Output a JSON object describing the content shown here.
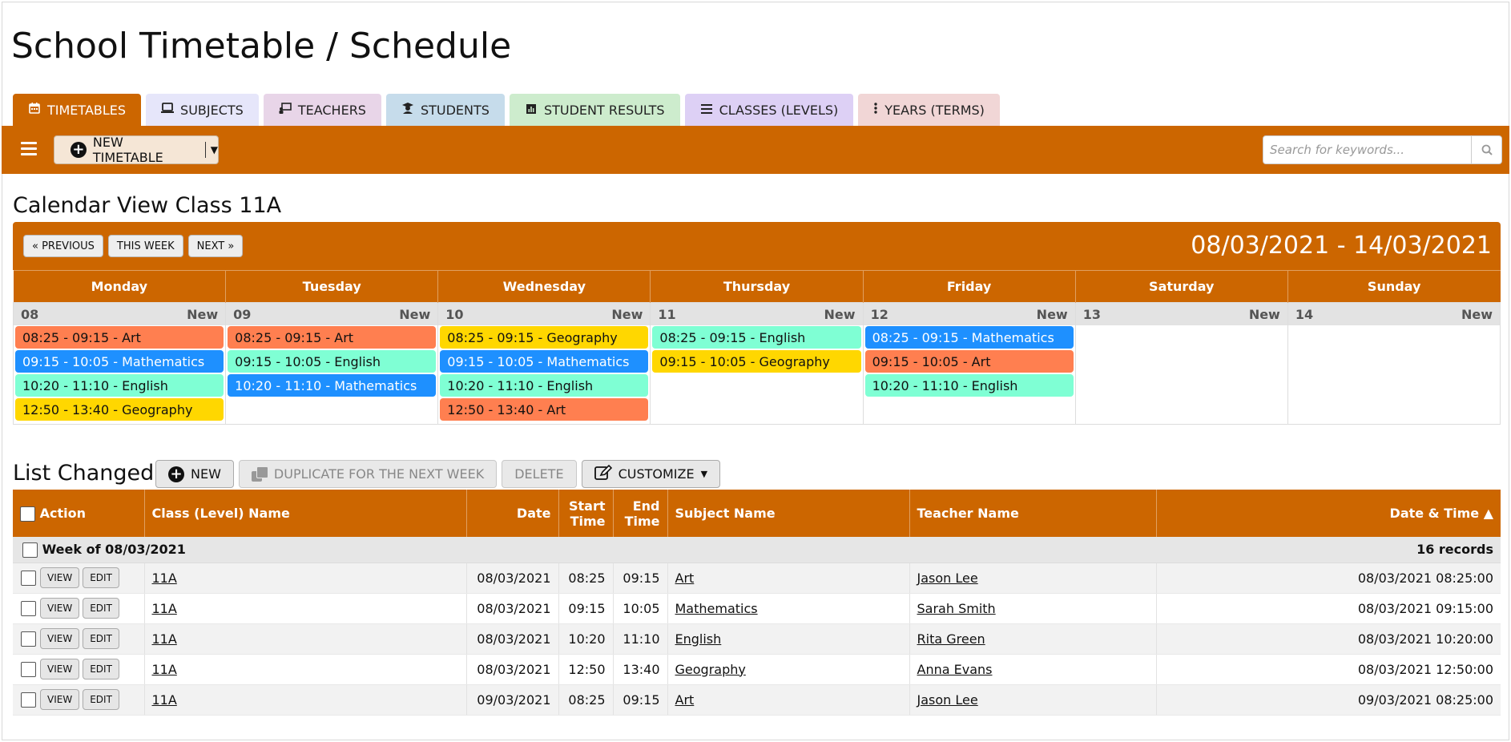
{
  "page": {
    "title": "School Timetable / Schedule"
  },
  "tabs": [
    {
      "label": "TIMETABLES",
      "icon": "calendar-icon",
      "color": "#cc6600"
    },
    {
      "label": "SUBJECTS",
      "icon": "laptop-icon",
      "color": "#e6e6fa"
    },
    {
      "label": "TEACHERS",
      "icon": "chalkboard-teacher-icon",
      "color": "#e8d5e8"
    },
    {
      "label": "STUDENTS",
      "icon": "user-graduate-icon",
      "color": "#c6dceb"
    },
    {
      "label": "STUDENT RESULTS",
      "icon": "chart-icon",
      "color": "#cdeccd"
    },
    {
      "label": "CLASSES (LEVELS)",
      "icon": "list-icon",
      "color": "#ddd0f5"
    },
    {
      "label": "YEARS (TERMS)",
      "icon": "ellipsis-vertical-icon",
      "color": "#f1d6d6"
    }
  ],
  "toolbar": {
    "new_timetable_label": "NEW TIMETABLE",
    "search_placeholder": "Search for keywords..."
  },
  "calendar": {
    "title": "Calendar View Class 11A",
    "prev_label": "« PREVIOUS",
    "this_week_label": "THIS WEEK",
    "next_label": "NEXT »",
    "range": "08/03/2021 - 14/03/2021",
    "new_label": "New",
    "days": [
      {
        "name": "Monday",
        "date": "08",
        "events": [
          {
            "text": "08:25 - 09:15 - Art",
            "type": "art"
          },
          {
            "text": "09:15 - 10:05 - Mathematics",
            "type": "math"
          },
          {
            "text": "10:20 - 11:10 - English",
            "type": "eng"
          },
          {
            "text": "12:50 - 13:40 - Geography",
            "type": "geo"
          }
        ]
      },
      {
        "name": "Tuesday",
        "date": "09",
        "events": [
          {
            "text": "08:25 - 09:15 - Art",
            "type": "art"
          },
          {
            "text": "09:15 - 10:05 - English",
            "type": "eng"
          },
          {
            "text": "10:20 - 11:10 - Mathematics",
            "type": "math"
          }
        ]
      },
      {
        "name": "Wednesday",
        "date": "10",
        "events": [
          {
            "text": "08:25 - 09:15 - Geography",
            "type": "geo"
          },
          {
            "text": "09:15 - 10:05 - Mathematics",
            "type": "math"
          },
          {
            "text": "10:20 - 11:10 - English",
            "type": "eng"
          },
          {
            "text": "12:50 - 13:40 - Art",
            "type": "art"
          }
        ]
      },
      {
        "name": "Thursday",
        "date": "11",
        "events": [
          {
            "text": "08:25 - 09:15 - English",
            "type": "eng"
          },
          {
            "text": "09:15 - 10:05 - Geography",
            "type": "geo"
          }
        ]
      },
      {
        "name": "Friday",
        "date": "12",
        "events": [
          {
            "text": "08:25 - 09:15 - Mathematics",
            "type": "math"
          },
          {
            "text": "09:15 - 10:05 - Art",
            "type": "art"
          },
          {
            "text": "10:20 - 11:10 - English",
            "type": "eng"
          }
        ]
      },
      {
        "name": "Saturday",
        "date": "13",
        "events": []
      },
      {
        "name": "Sunday",
        "date": "14",
        "events": []
      }
    ]
  },
  "list": {
    "title": "List Changed",
    "buttons": {
      "new_label": "NEW",
      "duplicate_label": "DUPLICATE FOR THE NEXT WEEK",
      "delete_label": "DELETE",
      "customize_label": "CUSTOMIZE"
    },
    "columns": {
      "action": "Action",
      "class_name": "Class (Level) Name",
      "date": "Date",
      "start_time_1": "Start",
      "start_time_2": "Time",
      "end_time_1": "End",
      "end_time_2": "Time",
      "subject": "Subject Name",
      "teacher": "Teacher Name",
      "datetime": "Date & Time ▲"
    },
    "group": {
      "label": "Week of 08/03/2021",
      "count": "16 records"
    },
    "view_label": "VIEW",
    "edit_label": "EDIT",
    "rows": [
      {
        "class_name": "11A",
        "date": "08/03/2021",
        "start": "08:25",
        "end": "09:15",
        "subject": "Art",
        "teacher": "Jason Lee",
        "datetime": "08/03/2021 08:25:00"
      },
      {
        "class_name": "11A",
        "date": "08/03/2021",
        "start": "09:15",
        "end": "10:05",
        "subject": "Mathematics",
        "teacher": "Sarah Smith",
        "datetime": "08/03/2021 09:15:00"
      },
      {
        "class_name": "11A",
        "date": "08/03/2021",
        "start": "10:20",
        "end": "11:10",
        "subject": "English",
        "teacher": "Rita Green",
        "datetime": "08/03/2021 10:20:00"
      },
      {
        "class_name": "11A",
        "date": "08/03/2021",
        "start": "12:50",
        "end": "13:40",
        "subject": "Geography",
        "teacher": "Anna Evans",
        "datetime": "08/03/2021 12:50:00"
      },
      {
        "class_name": "11A",
        "date": "09/03/2021",
        "start": "08:25",
        "end": "09:15",
        "subject": "Art",
        "teacher": "Jason Lee",
        "datetime": "09/03/2021 08:25:00"
      }
    ]
  },
  "colors": {
    "accent": "#cc6600",
    "art": "#ff7f50",
    "math": "#1e90ff",
    "eng": "#7fffd4",
    "geo": "#ffd700"
  }
}
